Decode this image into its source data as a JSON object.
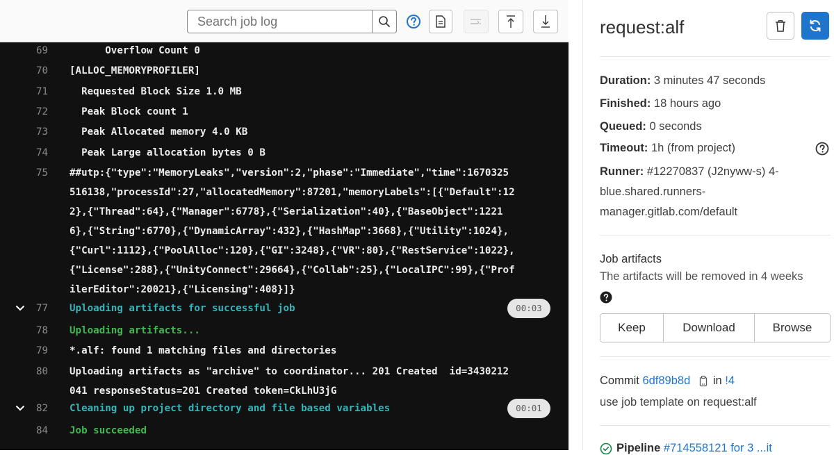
{
  "toolbar": {
    "search_placeholder": "Search job log"
  },
  "log": {
    "lines": [
      {
        "n": "",
        "text": "",
        "style": "partial"
      },
      {
        "n": "69",
        "text": "      Overflow Count 0",
        "style": "normal"
      },
      {
        "n": "70",
        "text": "[ALLOC_MEMORYPROFILER]",
        "style": "normal"
      },
      {
        "n": "71",
        "text": "  Requested Block Size 1.0 MB",
        "style": "normal"
      },
      {
        "n": "72",
        "text": "  Peak Block count 1",
        "style": "normal"
      },
      {
        "n": "73",
        "text": "  Peak Allocated memory 4.0 KB",
        "style": "normal"
      },
      {
        "n": "74",
        "text": "  Peak Large allocation bytes 0 B",
        "style": "normal"
      },
      {
        "n": "75",
        "text": "##utp:{\"type\":\"MemoryLeaks\",\"version\":2,\"phase\":\"Immediate\",\"time\":1670325",
        "style": "normal"
      },
      {
        "n": "",
        "text": "516138,\"processId\":27,\"allocatedMemory\":87201,\"memoryLabels\":[{\"Default\":12",
        "style": "normal"
      },
      {
        "n": "",
        "text": "2},{\"Thread\":64},{\"Manager\":6778},{\"Serialization\":40},{\"BaseObject\":1221",
        "style": "normal"
      },
      {
        "n": "",
        "text": "6},{\"String\":6770},{\"DynamicArray\":432},{\"HashMap\":3668},{\"Utility\":1024},",
        "style": "normal"
      },
      {
        "n": "",
        "text": "{\"Curl\":1112},{\"PoolAlloc\":120},{\"GI\":3248},{\"VR\":80},{\"RestService\":1022},",
        "style": "normal"
      },
      {
        "n": "",
        "text": "{\"License\":288},{\"UnityConnect\":29664},{\"Collab\":25},{\"LocalIPC\":99},{\"Prof",
        "style": "normal"
      },
      {
        "n": "",
        "text": "ilerEditor\":20021},{\"Licensing\":408}]}",
        "style": "normal"
      },
      {
        "n": "77",
        "text": "Uploading artifacts for successful job",
        "style": "cyan",
        "section": true,
        "duration": "00:03"
      },
      {
        "n": "78",
        "text": "Uploading artifacts...",
        "style": "green"
      },
      {
        "n": "79",
        "text": "*.alf: found 1 matching files and directories",
        "style": "normal"
      },
      {
        "n": "80",
        "text": "Uploading artifacts as \"archive\" to coordinator... 201 Created  id=3430212",
        "style": "normal"
      },
      {
        "n": "",
        "text": "041 responseStatus=201 Created token=CkLhU3jG",
        "style": "normal"
      },
      {
        "n": "82",
        "text": "Cleaning up project directory and file based variables",
        "style": "cyan",
        "section": true,
        "duration": "00:01"
      },
      {
        "n": "84",
        "text": "Job succeeded",
        "style": "green"
      }
    ]
  },
  "sidebar": {
    "title": "request:alf",
    "duration_label": "Duration:",
    "duration_value": " 3 minutes 47 seconds",
    "finished_label": "Finished:",
    "finished_value": " 18 hours ago",
    "queued_label": "Queued:",
    "queued_value": " 0 seconds",
    "timeout_label": "Timeout:",
    "timeout_value": " 1h (from project)",
    "runner_label": "Runner:",
    "runner_value": " #12270837 (J2nyww-s) 4-blue.shared.runners-manager.gitlab.com/default",
    "artifacts_title": "Job artifacts",
    "artifacts_desc": "The artifacts will be removed in 4 weeks",
    "keep_label": "Keep",
    "download_label": "Download",
    "browse_label": "Browse",
    "commit_label": "Commit",
    "commit_sha": "6df89b8d",
    "commit_in": "in",
    "commit_mr": "!4",
    "commit_message": "use job template on request:alf",
    "pipeline_label": "Pipeline",
    "pipeline_rest": "#714558121 for 3 ...it"
  },
  "colors": {
    "accent": "#1f75cb",
    "log_background": "#111111",
    "success_green": "#3fb950",
    "section_cyan": "#35b5b9"
  }
}
